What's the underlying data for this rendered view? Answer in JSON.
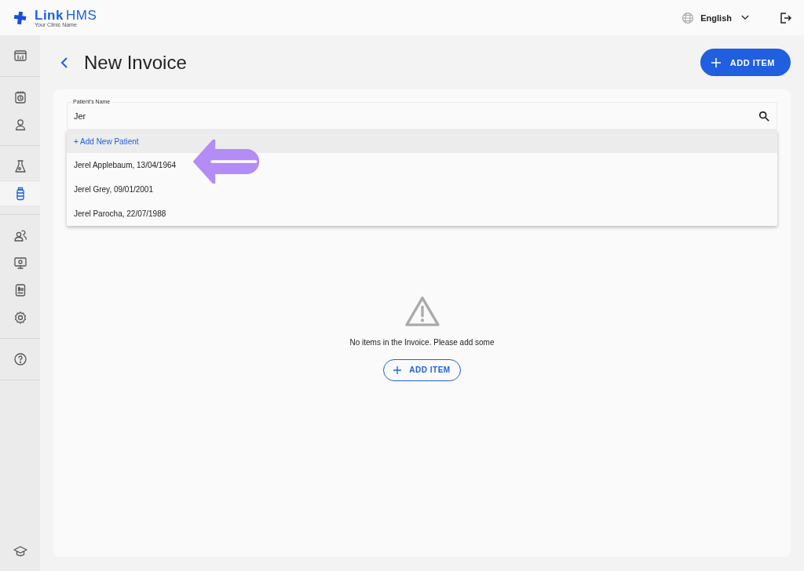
{
  "brand": {
    "name_bold": "Link",
    "name_rest": "HMS",
    "tagline": "Your Clinic Name"
  },
  "header": {
    "language": "English"
  },
  "sidebar": {
    "groups": [
      [
        {
          "selected": false
        }
      ],
      [
        {
          "selected": false
        },
        {
          "selected": false
        }
      ],
      [
        {
          "selected": false
        },
        {
          "selected": true
        }
      ],
      [
        {
          "selected": false
        },
        {
          "selected": false
        },
        {
          "selected": false
        },
        {
          "selected": false
        }
      ],
      [
        {
          "selected": false
        }
      ]
    ]
  },
  "page": {
    "title": "New Invoice",
    "add_button": "ADD ITEM"
  },
  "patient_field": {
    "label": "Patient's Name",
    "value": "Jer"
  },
  "dropdown": {
    "add_option": "+ Add New Patient",
    "add_highlighted": true,
    "options": [
      {
        "label": "Jerel Applebaum, 13/04/1964",
        "selected": false
      },
      {
        "label": "Jerel Grey, 09/01/2001",
        "selected": false
      },
      {
        "label": "Jerel Parocha, 22/07/1988",
        "selected": false
      }
    ]
  },
  "empty_state": {
    "message": "No items in the Invoice. Please add some",
    "button": "ADD ITEM"
  }
}
